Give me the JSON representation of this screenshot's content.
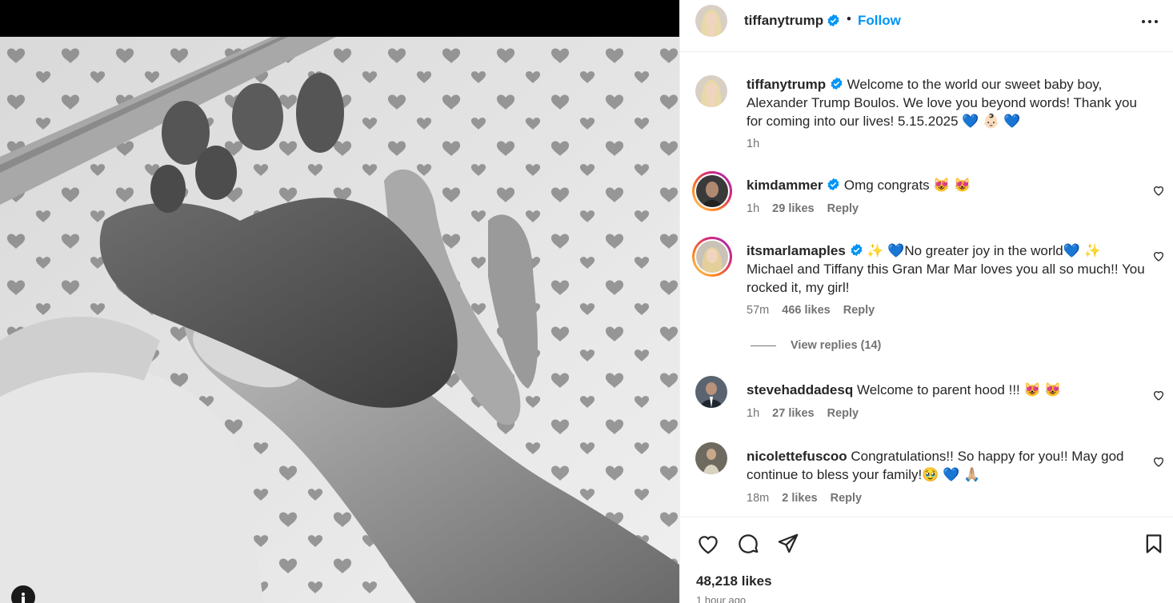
{
  "post": {
    "username": "tiffanytrump",
    "follow_label": "Follow",
    "separator": "•",
    "more_label": "•••"
  },
  "caption": {
    "username": "tiffanytrump",
    "text": "Welcome to the world our sweet baby boy, Alexander Trump Boulos. We love you beyond words! Thank you for coming into our lives! 5.15.2025 💙 👶🏻 💙",
    "time": "1h"
  },
  "comments": [
    {
      "username": "kimdammer",
      "verified": true,
      "text": "Omg congrats 😻 😻",
      "time": "1h",
      "likes": "29 likes",
      "reply": "Reply",
      "story_ring": true
    },
    {
      "username": "itsmarlamaples",
      "verified": true,
      "text": "✨ 💙No greater joy in the world💙 ✨ Michael and Tiffany this Gran Mar Mar loves you all so much!! You rocked it, my girl!",
      "time": "57m",
      "likes": "466 likes",
      "reply": "Reply",
      "story_ring": true,
      "view_replies": "View replies (14)"
    },
    {
      "username": "stevehaddadesq",
      "verified": false,
      "text": "Welcome to parent hood !!! 😻 😻",
      "time": "1h",
      "likes": "27 likes",
      "reply": "Reply",
      "story_ring": false
    },
    {
      "username": "nicolettefuscoo",
      "verified": false,
      "text": "Congratulations!! So happy for you!! May god continue to bless your family!🥹 💙 🙏🏼",
      "time": "18m",
      "likes": "2 likes",
      "reply": "Reply",
      "story_ring": false
    }
  ],
  "footer": {
    "likes": "48,218 likes",
    "time": "1 hour ago"
  },
  "colors": {
    "accent": "#0095f6",
    "verified": "#0095f6",
    "text": "#262626",
    "muted": "#737373"
  },
  "icons": [
    "verified-badge-icon",
    "more-icon",
    "heart-icon",
    "comment-icon",
    "share-icon",
    "bookmark-icon",
    "info-icon"
  ]
}
